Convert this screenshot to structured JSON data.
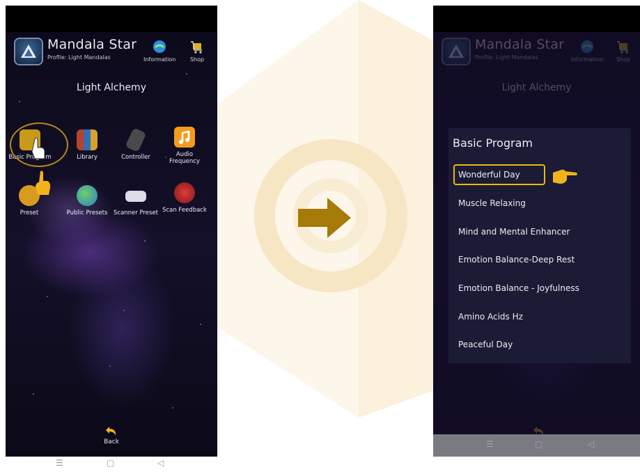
{
  "app": {
    "title": "Mandala Star",
    "profile": "Profile: Light Mandalas",
    "info_label": "Information",
    "shop_label": "Shop",
    "heading": "Light Alchemy",
    "back_label": "Back"
  },
  "tiles": [
    {
      "label": "Basic Program",
      "icon": "touch-program-icon"
    },
    {
      "label": "Library",
      "icon": "books-icon"
    },
    {
      "label": "Controller",
      "icon": "device-icon"
    },
    {
      "label": "Audio Frequency",
      "icon": "music-note-icon"
    },
    {
      "label": "Preset",
      "icon": "preset-icon"
    },
    {
      "label": "Public Presets",
      "icon": "globe-icon"
    },
    {
      "label": "Scanner Preset",
      "icon": "scanner-icon"
    },
    {
      "label": "Scan Feedback",
      "icon": "heart-scan-icon"
    }
  ],
  "panel": {
    "title": "Basic Program",
    "items": [
      "Wonderful Day",
      "Muscle Relaxing",
      "Mind and Mental Enhancer",
      "Emotion Balance-Deep Rest",
      "Emotion Balance - Joyfulness",
      "Amino Acids Hz",
      "Peaceful Day"
    ],
    "selected_index": 0
  },
  "navbar": {
    "menu": "☰",
    "home": "▢",
    "back": "◁"
  },
  "colors": {
    "highlight": "#f0b90c",
    "arrow": "#a57a08",
    "circle": "#b48a16"
  }
}
